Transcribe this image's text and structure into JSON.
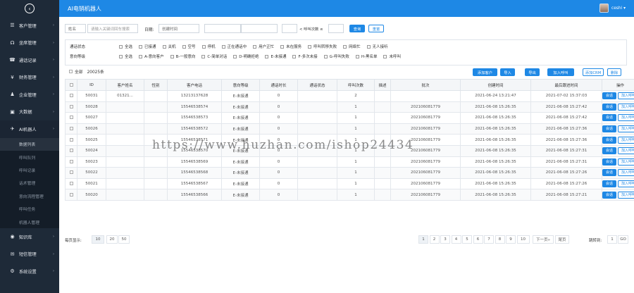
{
  "header": {
    "title": "AI电销机器人",
    "user": "ceshi",
    "user_caret": "▾"
  },
  "logo_icon": "back-arrow-icon",
  "sidebar": {
    "items": [
      {
        "label": "客户管理",
        "icon": "list-icon",
        "glyph": "☰"
      },
      {
        "label": "坐席管理",
        "icon": "headset-icon",
        "glyph": "☊"
      },
      {
        "label": "通话记录",
        "icon": "phone-icon",
        "glyph": "☎"
      },
      {
        "label": "财务管理",
        "icon": "yen-icon",
        "glyph": "¥"
      },
      {
        "label": "企业管理",
        "icon": "user-icon",
        "glyph": "♟"
      },
      {
        "label": "大数据",
        "icon": "briefcase-icon",
        "glyph": "▣"
      },
      {
        "label": "AI机器人",
        "icon": "robot-icon",
        "glyph": "✈"
      }
    ],
    "sub_items": [
      "数据列表",
      "呼叫队列",
      "呼叫记录",
      "话术管理",
      "意向流程管理",
      "呼叫任务",
      "机器人管理"
    ],
    "bottom_items": [
      {
        "label": "知识库",
        "icon": "globe-icon",
        "glyph": "◉"
      },
      {
        "label": "短信管理",
        "icon": "envelope-icon",
        "glyph": "✉"
      },
      {
        "label": "系统设置",
        "icon": "gear-icon",
        "glyph": "⚙"
      }
    ],
    "arrow": "›"
  },
  "search": {
    "type_select": "姓名",
    "keyword_placeholder": "请输入关键词回车搜索",
    "date_label": "日期:",
    "date_select": "创建时间",
    "range_sep": "-",
    "call_count_placeholder": "< 呼叫次数 ≤",
    "search_btn": "查询",
    "reset_btn": "重置"
  },
  "filters": {
    "status_label": "通话状态",
    "status_options": [
      "全选",
      "已接通",
      "关机",
      "空号",
      "停机",
      "正在通话中",
      "用户正忙",
      "未在服务",
      "呼叫转移失败",
      "网络忙",
      "无人接听"
    ],
    "intent_label": "意向等级",
    "intent_options": [
      "全选",
      "A-意向客户",
      "B-一般意向",
      "C-简单对话",
      "D-明确拒绝",
      "E-未接通",
      "F-多次未接",
      "G-呼叫失败",
      "H-黑名单",
      "未呼叫"
    ]
  },
  "toolbar": {
    "select_all": "全部",
    "count": "20025条",
    "buttons": [
      "添加客户",
      "导入",
      "导出",
      "加入呼叫",
      "添加CRM",
      "删除"
    ]
  },
  "table": {
    "headers": [
      "ID",
      "客户姓名",
      "性别",
      "客户电话",
      "意向等级",
      "通话时长",
      "通话状态",
      "呼叫次数",
      "描述",
      "批次",
      "创建时间",
      "最后跟进时间",
      "操作"
    ],
    "op_session": "会话",
    "op_call": "加入呼叫",
    "rows": [
      [
        "50031",
        "01321...",
        "",
        "13213137628",
        "E-未接通",
        "0",
        "",
        "2",
        "",
        "",
        "2021-06-24 13:21:47",
        "2021-07-02 15:37:03"
      ],
      [
        "50028",
        "",
        "",
        "15546538574",
        "E-未接通",
        "0",
        "",
        "1",
        "",
        "202106081779",
        "2021-06-08 15:26:35",
        "2021-06-08 15:27:42"
      ],
      [
        "50027",
        "",
        "",
        "15546538573",
        "E-未接通",
        "0",
        "",
        "1",
        "",
        "202106081779",
        "2021-06-08 15:26:35",
        "2021-06-08 15:27:42"
      ],
      [
        "50026",
        "",
        "",
        "15546538572",
        "E-未接通",
        "0",
        "",
        "1",
        "",
        "202106081779",
        "2021-06-08 15:26:35",
        "2021-06-08 15:27:36"
      ],
      [
        "50025",
        "",
        "",
        "15546538571",
        "E-未接通",
        "0",
        "",
        "1",
        "",
        "202106081779",
        "2021-06-08 15:26:35",
        "2021-06-08 15:27:36"
      ],
      [
        "50024",
        "",
        "",
        "15546538570",
        "E-未接通",
        "0",
        "",
        "1",
        "",
        "202106081779",
        "2021-06-08 15:26:35",
        "2021-06-08 15:27:31"
      ],
      [
        "50023",
        "",
        "",
        "15546538569",
        "E-未接通",
        "0",
        "",
        "1",
        "",
        "202106081779",
        "2021-06-08 15:26:35",
        "2021-06-08 15:27:31"
      ],
      [
        "50022",
        "",
        "",
        "15546538568",
        "E-未接通",
        "0",
        "",
        "1",
        "",
        "202106081779",
        "2021-06-08 15:26:35",
        "2021-06-08 15:27:26"
      ],
      [
        "50021",
        "",
        "",
        "15546538567",
        "E-未接通",
        "0",
        "",
        "1",
        "",
        "202106081779",
        "2021-06-08 15:26:35",
        "2021-06-08 15:27:26"
      ],
      [
        "50020",
        "",
        "",
        "15546538566",
        "E-未接通",
        "0",
        "",
        "1",
        "",
        "202106081779",
        "2021-06-08 15:26:35",
        "2021-06-08 15:27:21"
      ]
    ]
  },
  "footer": {
    "per_page_label": "每页显示:",
    "per_page_options": [
      "10",
      "20",
      "50"
    ],
    "pages": [
      "1",
      "2",
      "3",
      "4",
      "5",
      "6",
      "7",
      "8",
      "9",
      "10"
    ],
    "next": "下一页»",
    "last": "尾页",
    "jump_label": "跳转到:",
    "jump_value": "1",
    "go": "GO"
  },
  "watermark": "https://www.huzhan.com/ishop24434",
  "colors": {
    "primary": "#1e88e5",
    "sidebar": "#1e2a38",
    "background": "#e9eef3"
  }
}
